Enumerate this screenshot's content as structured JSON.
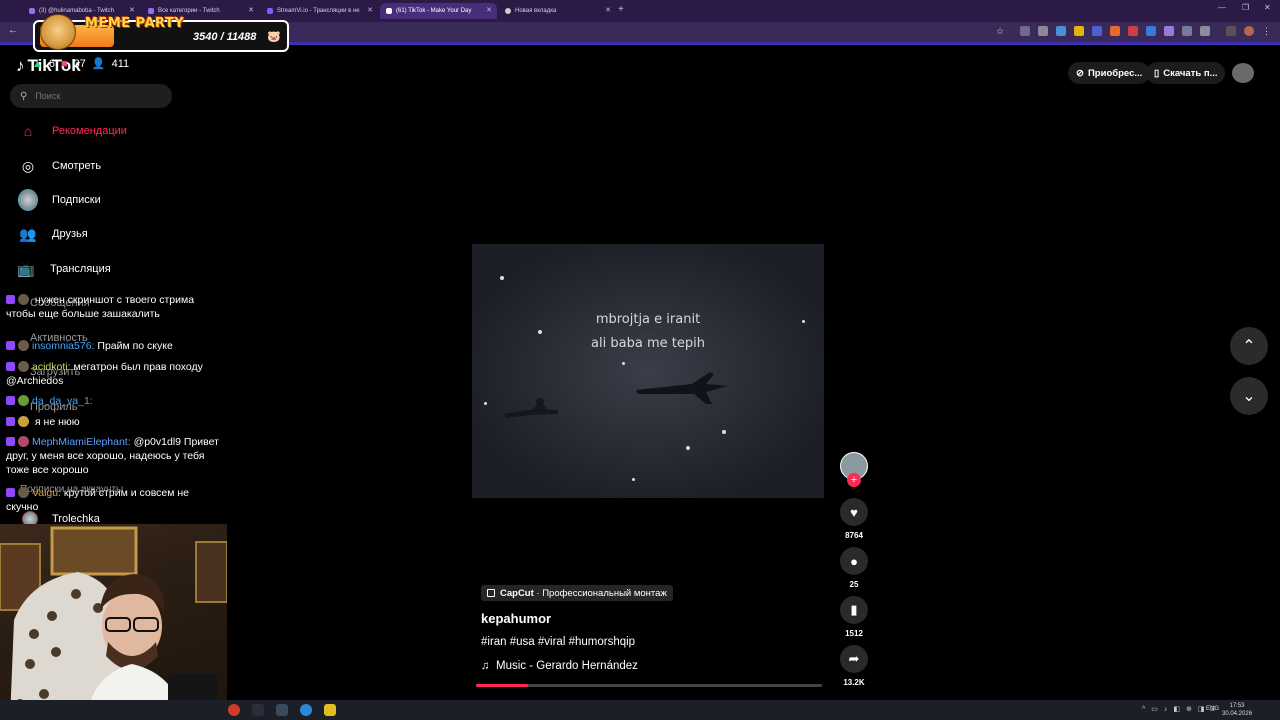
{
  "browser": {
    "tabs": [
      {
        "title": "(3) @hulinamaboba - Twitch",
        "active": false
      },
      {
        "title": "Все категории - Twitch",
        "active": false
      },
      {
        "title": "StreamVi.io - Трансляции в не",
        "active": false
      },
      {
        "title": "(61) TikTok - Make Your Day",
        "active": true
      },
      {
        "title": "Новая вкладка",
        "active": false
      }
    ],
    "accent_color": "#3d2fb0"
  },
  "meme_overlay": {
    "title": "MEME PARTY",
    "count": "3540 / 11488"
  },
  "stream_stats": {
    "item1": "6",
    "item2": "37",
    "item3": "411"
  },
  "tiktok": {
    "logo": "TikTok",
    "search_placeholder": "Поиск",
    "nav": [
      {
        "label": "Рекомендации",
        "icon": "home-icon"
      },
      {
        "label": "Смотреть",
        "icon": "compass-icon"
      },
      {
        "label": "Подписки",
        "icon": "avatar"
      },
      {
        "label": "Друзья",
        "icon": "friends-icon"
      },
      {
        "label": "Трансляция",
        "icon": "live-icon"
      },
      {
        "label": "Сообщения",
        "icon": "message-icon"
      },
      {
        "label": "Активность",
        "icon": "bell-icon"
      },
      {
        "label": "Загрузить",
        "icon": "upload-icon"
      },
      {
        "label": "Профиль",
        "icon": "profile-icon"
      },
      {
        "label": "Подписки на аккаунты",
        "icon": ""
      },
      {
        "label": "Trolechka",
        "icon": "avatar"
      }
    ],
    "top_right": {
      "get_app": "Приобрес...",
      "download": "Скачать п..."
    },
    "video": {
      "overlay_line1": "mbrojtja e iranit",
      "overlay_line2": "ali baba me tepih",
      "progress": 0.15
    },
    "actions": {
      "likes": "8764",
      "comments": "25",
      "saves": "1512",
      "shares": "13.2K"
    },
    "caption": {
      "capcut_brand": "CapCut",
      "capcut_text": " · Профессиональный монтаж",
      "author": "kepahumor",
      "hashtags": "#iran #usa #viral #humorshqip",
      "music": "Music - Gerardo Hernández"
    },
    "brand_color": "#fe2c55"
  },
  "chat": [
    {
      "user": "",
      "text": "нужен скриншот с твоего стрима чтобы еще больше зашакалить",
      "color": "#ff6a6a"
    },
    {
      "user": "insomnia576:",
      "text": "Прайм по скуке",
      "color": "#3ea6ff"
    },
    {
      "user": "acidkoti:",
      "text": "мегатрон был прав походу @Archiedos",
      "color": "#c4e06a"
    },
    {
      "user": "da_da_va_1:",
      "text": "",
      "color": "#3ea6ff"
    },
    {
      "user": "",
      "text": "я не нюю",
      "color": "#3a5cff"
    },
    {
      "user": "MephMiamiElephant:",
      "text": "@p0v1dl9 Привет друг, у меня все хорошо, надеюсь у тебя тоже все хорошо",
      "color": "#5aa0ff"
    },
    {
      "user": "Vaigu:",
      "text": "крутой стрим и совсем не скучно",
      "color": "#e0a050"
    }
  ],
  "taskbar": {
    "lang": "ENG",
    "time": "17:53",
    "date": "30.04.2026"
  }
}
